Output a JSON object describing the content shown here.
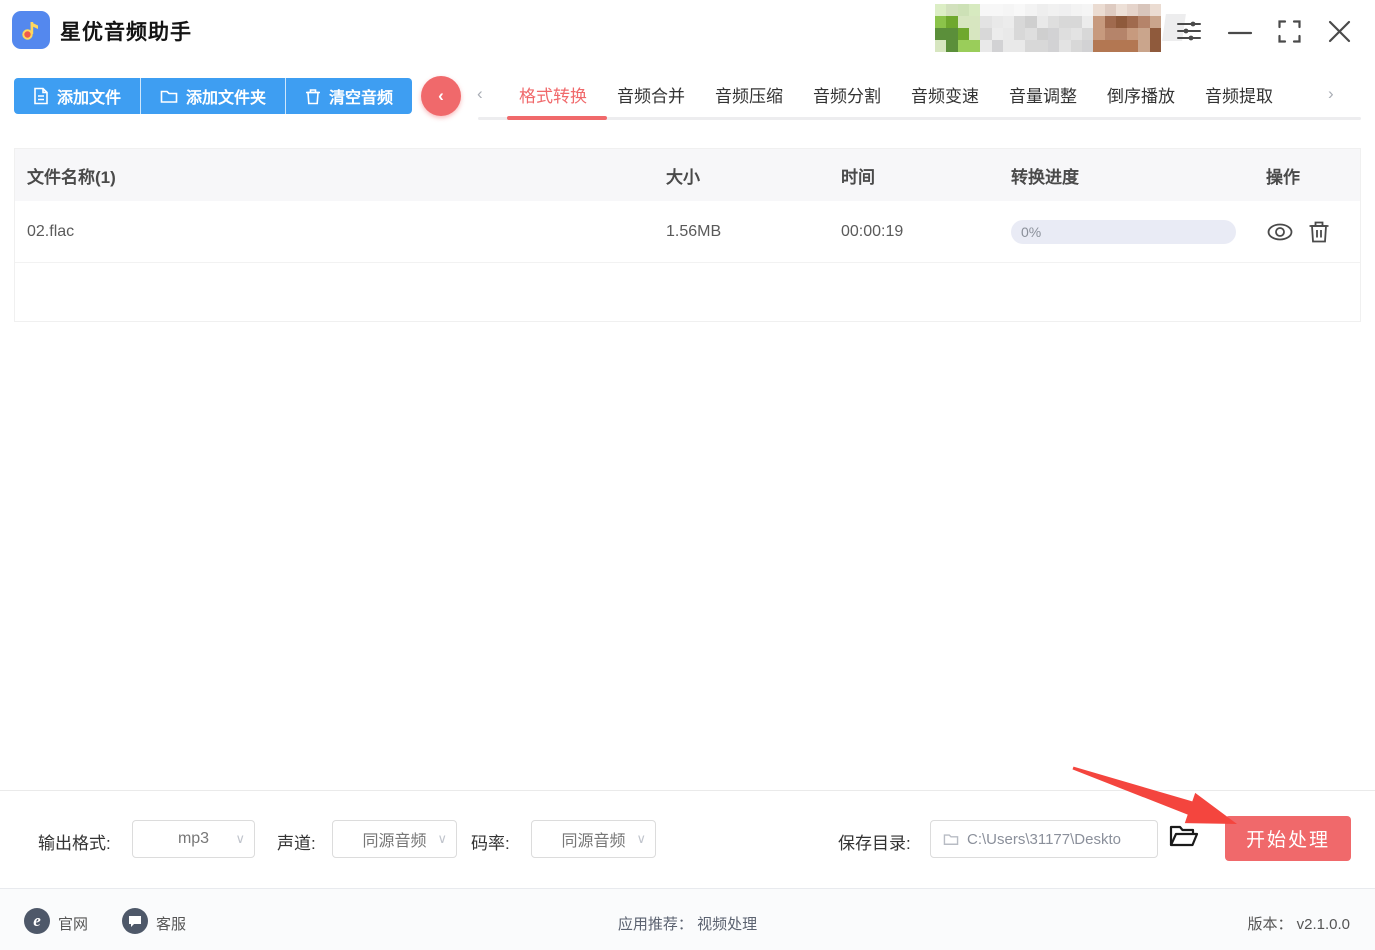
{
  "window": {
    "title": "星优音频助手"
  },
  "toolbar": {
    "buttons": [
      {
        "key": "add-file",
        "label": "添加文件"
      },
      {
        "key": "add-folder",
        "label": "添加文件夹"
      },
      {
        "key": "clear-audio",
        "label": "清空音频"
      }
    ],
    "back_chevron": "‹"
  },
  "tabs": {
    "active": "格式转换",
    "left_chevron": "‹",
    "right_chevron": "›",
    "items": [
      {
        "key": "format-convert",
        "label": "格式转换"
      },
      {
        "key": "audio-merge",
        "label": "音频合并"
      },
      {
        "key": "audio-compress",
        "label": "音频压缩"
      },
      {
        "key": "audio-split",
        "label": "音频分割"
      },
      {
        "key": "audio-speed",
        "label": "音频变速"
      },
      {
        "key": "volume-adjust",
        "label": "音量调整"
      },
      {
        "key": "reverse-play",
        "label": "倒序播放"
      },
      {
        "key": "audio-extract",
        "label": "音频提取"
      }
    ]
  },
  "table": {
    "columns": [
      "文件名称(1)",
      "大小",
      "时间",
      "转换进度",
      "操作"
    ],
    "rows": [
      {
        "name": "02.flac",
        "size": "1.56MB",
        "duration": "00:00:19",
        "progress": "0%"
      }
    ]
  },
  "settings": {
    "output_format_label": "输出格式:",
    "output_format_value": "mp3",
    "channel_label": "声道:",
    "channel_value": "同源音频",
    "bitrate_label": "码率:",
    "bitrate_value": "同源音频",
    "save_dir_label": "保存目录:",
    "save_dir_value": "C:\\Users\\31177\\Deskto",
    "start_button": "开始处理",
    "chevron": "∨"
  },
  "footer": {
    "official_site": "官网",
    "support": "客服",
    "recommend_label": "应用推荐：",
    "recommend_value": "视频处理",
    "version_text": "版本：  v2.1.0.0"
  },
  "colors": {
    "primary_blue": "#3e9ef2",
    "accent_red": "#f0696b",
    "arrow_red": "#f4453e",
    "progress_bg": "#e9ebf5",
    "header_row_bg": "#f7f7f9",
    "footer_icon_bg": "#4e5869"
  },
  "redaction": {
    "green_palette": [
      "#6fa82e",
      "#8bc34a",
      "#5b8f3a",
      "#9acd5a",
      "#7da843",
      "#4e7d35",
      "#a8c87e",
      "#d7e6c0"
    ],
    "gray_palette": [
      "#e3e3e3",
      "#d8d8d8",
      "#cfcfcf",
      "#e9e9e9",
      "#dedede",
      "#d2d2d4",
      "#ececec"
    ],
    "brown_palette": [
      "#b5846a",
      "#a06a4e",
      "#c79a7e",
      "#8f5a3c",
      "#caa58c",
      "#b37752"
    ]
  }
}
